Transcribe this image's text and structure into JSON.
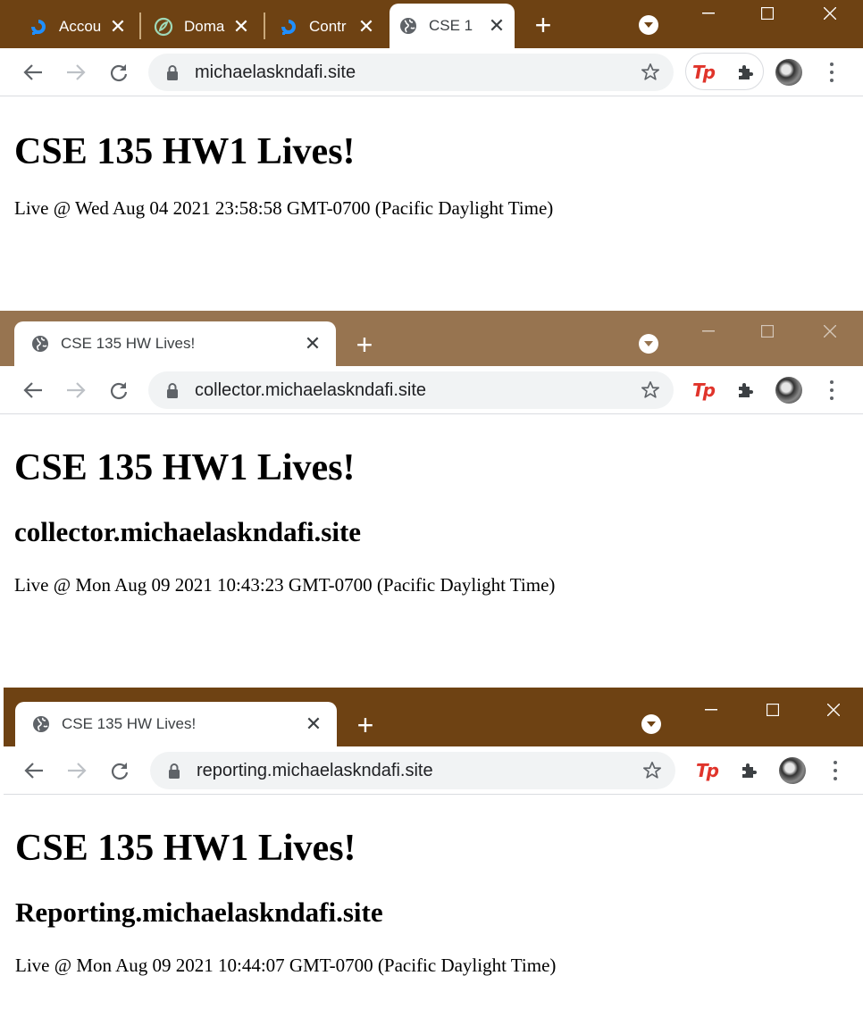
{
  "window1": {
    "colors": {
      "frame": "#6e4213"
    },
    "tabs": [
      {
        "title": "Accou",
        "icon": "digitalocean-icon"
      },
      {
        "title": "Doma",
        "icon": "domain-logo-icon"
      },
      {
        "title": "Contr",
        "icon": "digitalocean-icon"
      },
      {
        "title": "CSE 1",
        "icon": "globe-icon",
        "active": true
      }
    ],
    "url": "michaelaskndafi.site",
    "page": {
      "heading": "CSE 135 HW1 Lives!",
      "live_text": "Live @ Wed Aug 04 2021 23:58:58 GMT-0700 (Pacific Daylight Time)"
    }
  },
  "window2": {
    "colors": {
      "frame": "#977450"
    },
    "tabs": [
      {
        "title": "CSE 135 HW Lives!",
        "icon": "globe-icon",
        "active": true
      }
    ],
    "url": "collector.michaelaskndafi.site",
    "page": {
      "heading": "CSE 135 HW1 Lives!",
      "subheading": "collector.michaelaskndafi.site",
      "live_text": "Live @ Mon Aug 09 2021 10:43:23 GMT-0700 (Pacific Daylight Time)"
    }
  },
  "window3": {
    "colors": {
      "frame": "#6e4213"
    },
    "tabs": [
      {
        "title": "CSE 135 HW Lives!",
        "icon": "globe-icon",
        "active": true
      }
    ],
    "url": "reporting.michaelaskndafi.site",
    "page": {
      "heading": "CSE 135 HW1 Lives!",
      "subheading": "Reporting.michaelaskndafi.site",
      "live_text": "Live @ Mon Aug 09 2021 10:44:07 GMT-0700 (Pacific Daylight Time)"
    }
  },
  "extensions": {
    "tp_label": "Tp"
  }
}
